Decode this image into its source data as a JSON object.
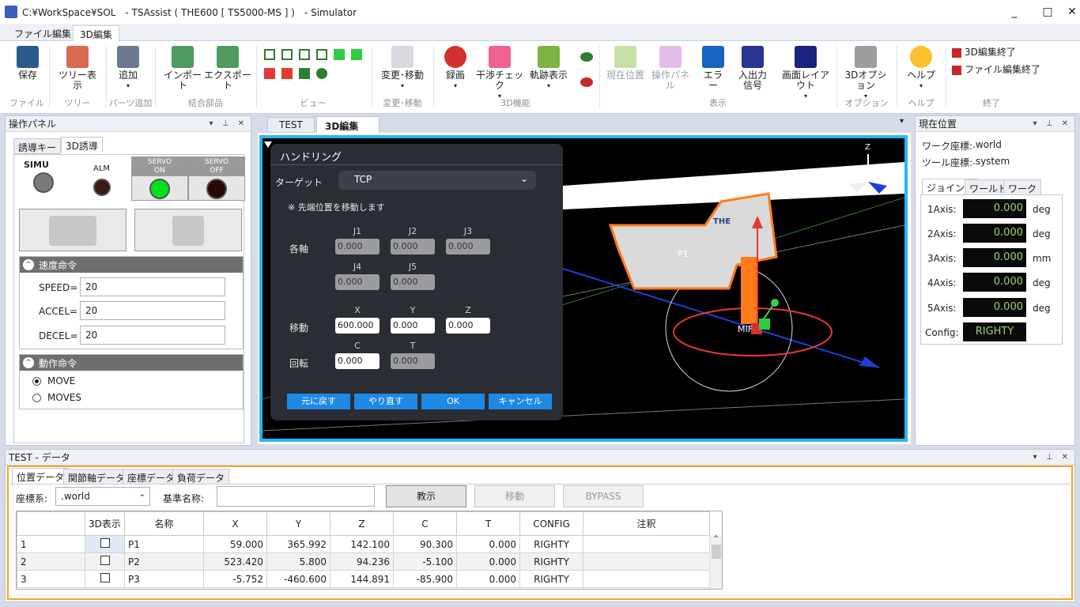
{
  "window": {
    "title": "C:¥WorkSpace¥SOL　- TSAssist ( THE600 [ TS5000-MS ] )　- Simulator",
    "minimize": "_",
    "maximize": "□",
    "close": "✕"
  },
  "ribbon_tabs": [
    "ファイル編集",
    "3D編集"
  ],
  "ribbon": {
    "save": "保存",
    "tree_view": "ツリー表示",
    "add": "追加",
    "import": "インポート",
    "export": "エクスポート",
    "change_move": "変更･移動",
    "record": "録画",
    "interference": "干渉チェック",
    "trajectory": "軌跡表示",
    "current_pos": "現在位置",
    "op_panel": "操作パネル",
    "error": "エラー",
    "io_signal": "入出力\n信号",
    "screen_layout": "画面レイアウト",
    "options_3d": "3Dオプション",
    "help": "ヘルプ",
    "end_3d": "3D編集終了",
    "end_file": "ファイル編集終了",
    "groups": {
      "file": "ファイル",
      "tree": "ツリー",
      "parts_add": "パーツ追加",
      "joint_parts": "結合部品",
      "view": "ビュー",
      "change": "変更･移動",
      "func3d": "3D機能",
      "display": "表示",
      "option": "オプション",
      "help": "ヘルプ",
      "end": "終了"
    }
  },
  "op_panel": {
    "title": "操作パネル",
    "tabs": [
      "誘導キー",
      "3D誘導"
    ],
    "simu": "SIMU",
    "alm": "ALM",
    "servo_on": "SERVO\nON",
    "servo_off": "SERVO\nOFF",
    "speed_header": "速度命令",
    "speed": {
      "label": "SPEED=",
      "value": "20"
    },
    "accel": {
      "label": "ACCEL=",
      "value": "20"
    },
    "decel": {
      "label": "DECEL=",
      "value": "20"
    },
    "motion_header": "動作命令",
    "motion_options": [
      "MOVE",
      "MOVES"
    ],
    "motion_selected": "MOVE"
  },
  "doc_tabs": [
    "TEST",
    "3D編集"
  ],
  "handling": {
    "title": "ハンドリング",
    "target_label": "ターゲット",
    "target_value": "TCP",
    "note": "※ 先端位置を移動します",
    "axes_label": "各軸",
    "j_labels": [
      "J1",
      "J2",
      "J3",
      "J4",
      "J5"
    ],
    "j_values": [
      "0.000",
      "0.000",
      "0.000",
      "0.000",
      "0.000"
    ],
    "move_label": "移動",
    "xyz_labels": [
      "X",
      "Y",
      "Z"
    ],
    "xyz_values": [
      "600.000",
      "0.000",
      "0.000"
    ],
    "rot_label": "回転",
    "ct_labels": [
      "C",
      "T"
    ],
    "ct_values": [
      "0.000",
      "0.000"
    ],
    "buttons": [
      "元に戻す",
      "やり直す",
      "OK",
      "キャンセル"
    ]
  },
  "scene": {
    "p1": "P1",
    "mif": "MIF",
    "axis_z": "Z",
    "axis_y": "Y",
    "brand": "THE"
  },
  "current_position": {
    "title": "現在位置",
    "work_coord_label": "ワーク座標:",
    "work_coord": ".world",
    "tool_coord_label": "ツール座標:",
    "tool_coord": ".system",
    "tabs": [
      "ジョイント",
      "ワールド",
      "ワーク"
    ],
    "axes": [
      {
        "label": "1Axis:",
        "value": "0.000",
        "unit": "deg"
      },
      {
        "label": "2Axis:",
        "value": "0.000",
        "unit": "deg"
      },
      {
        "label": "3Axis:",
        "value": "0.000",
        "unit": "mm"
      },
      {
        "label": "4Axis:",
        "value": "0.000",
        "unit": "deg"
      },
      {
        "label": "5Axis:",
        "value": "0.000",
        "unit": "deg"
      }
    ],
    "config_label": "Config:",
    "config_value": "RIGHTY"
  },
  "data_panel": {
    "title": "TEST - データ",
    "tabs": [
      "位置データ",
      "関節軸データ",
      "座標データ",
      "負荷データ"
    ],
    "coord_label": "座標系:",
    "coord_value": ".world",
    "base_name_label": "基準名称:",
    "base_name_value": "",
    "btn_teach": "教示",
    "btn_move": "移動",
    "btn_bypass": "BYPASS",
    "columns": [
      "",
      "3D表示",
      "名称",
      "X",
      "Y",
      "Z",
      "C",
      "T",
      "CONFIG",
      "注釈"
    ],
    "rows": [
      {
        "no": "1",
        "name": "P1",
        "x": "59.000",
        "y": "365.992",
        "z": "142.100",
        "c": "90.300",
        "t": "0.000",
        "config": "RIGHTY",
        "note": ""
      },
      {
        "no": "2",
        "name": "P2",
        "x": "523.420",
        "y": "5.800",
        "z": "94.236",
        "c": "-5.100",
        "t": "0.000",
        "config": "RIGHTY",
        "note": ""
      },
      {
        "no": "3",
        "name": "P3",
        "x": "-5.752",
        "y": "-460.600",
        "z": "144.891",
        "c": "-85.900",
        "t": "0.000",
        "config": "RIGHTY",
        "note": ""
      }
    ]
  },
  "icons": {
    "save": "floppy-icon",
    "record": "record-icon",
    "error": "warning-icon",
    "help": "lightbulb-icon",
    "options": "wrench-icon"
  }
}
